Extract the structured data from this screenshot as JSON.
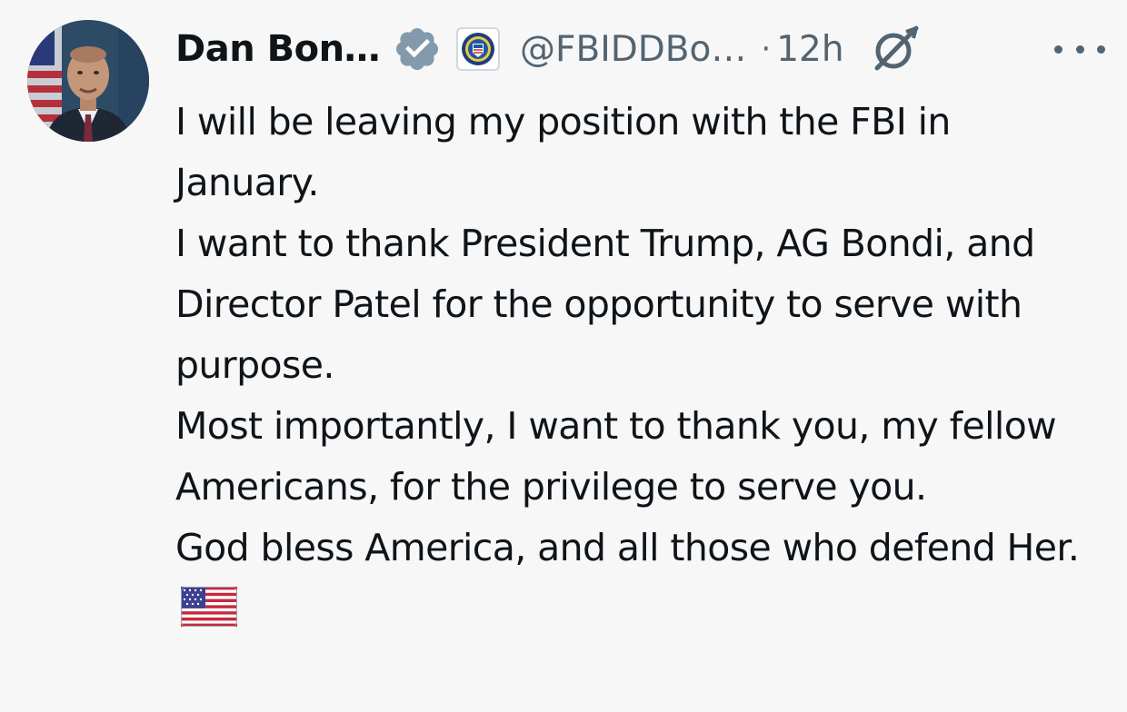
{
  "tweet": {
    "display_name": "Dan Bon…",
    "handle": "@FBIDDBo…",
    "separator": "·",
    "time": "12h",
    "paragraphs": [
      "I will be leaving my position with the FBI in January.",
      "I want to thank President Trump, AG Bondi, and Director Patel for the opportunity to serve with purpose.",
      "Most importantly, I want to thank you, my fellow Americans, for the privilege to serve you.",
      "God bless America, and all those who defend Her."
    ]
  },
  "icons": {
    "verified": "verified-badge-icon",
    "affiliate": "fbi-seal-icon",
    "grok": "grok-icon",
    "more": "more-options-icon",
    "flag": "us-flag-emoji"
  },
  "colors": {
    "background": "#f7f7f7",
    "text": "#0f1419",
    "secondary_text": "#536471",
    "verified_badge": "#829aab"
  }
}
